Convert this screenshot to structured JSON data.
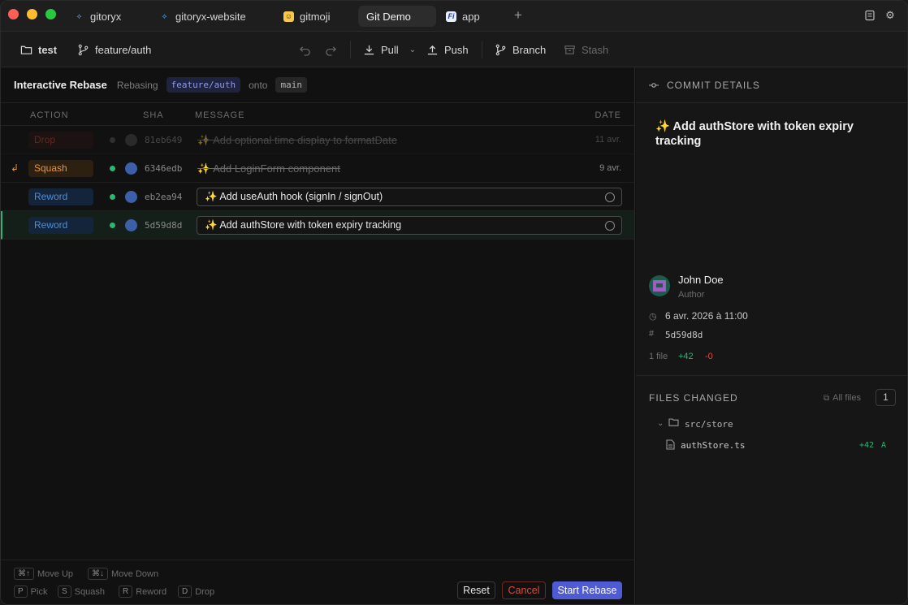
{
  "window": {
    "traffic_lights": {
      "close": "#fe5f57",
      "minimize": "#febc2e",
      "maximize": "#28c840"
    }
  },
  "tabs": [
    {
      "label": "gitoryx",
      "icon": "git-logo-icon"
    },
    {
      "label": "gitoryx-website",
      "icon": "git-logo-icon"
    },
    {
      "label": "gitmoji",
      "icon": "emoji-icon"
    },
    {
      "label": "Git Demo",
      "icon": "",
      "active": true
    },
    {
      "label": "app",
      "icon": "figma-icon"
    }
  ],
  "toolbar": {
    "repo": "test",
    "branch": "feature/auth",
    "pull": "Pull",
    "push": "Push",
    "branch_btn": "Branch",
    "stash": "Stash"
  },
  "rebase": {
    "title": "Interactive Rebase",
    "rebasing_label": "Rebasing",
    "source_branch": "feature/auth",
    "onto_label": "onto",
    "target_branch": "main"
  },
  "columns": {
    "action": "ACTION",
    "sha": "SHA",
    "message": "MESSAGE",
    "date": "DATE"
  },
  "commits": [
    {
      "action": "Drop",
      "sha": "81eb649",
      "message": "✨ Add optional time display to formatDate",
      "date": "11 avr."
    },
    {
      "action": "Squash",
      "sha": "6346edb",
      "message": "✨ Add LoginForm component",
      "date": "9 avr."
    },
    {
      "action": "Reword",
      "sha": "eb2ea94",
      "message": "✨ Add useAuth hook (signIn / signOut)",
      "date": ""
    },
    {
      "action": "Reword",
      "sha": "5d59d8d",
      "message": "✨ Add authStore with token expiry tracking",
      "date": ""
    }
  ],
  "footer": {
    "hints": [
      {
        "key": "⌘↑",
        "label": "Move Up"
      },
      {
        "key": "⌘↓",
        "label": "Move Down"
      },
      {
        "key": "P",
        "label": "Pick"
      },
      {
        "key": "S",
        "label": "Squash"
      },
      {
        "key": "R",
        "label": "Reword"
      },
      {
        "key": "D",
        "label": "Drop"
      }
    ],
    "reset": "Reset",
    "cancel": "Cancel",
    "start": "Start Rebase"
  },
  "details": {
    "section_title": "COMMIT DETAILS",
    "commit_title": "✨ Add authStore with token expiry tracking",
    "author_name": "John Doe",
    "author_role": "Author",
    "date": "6 avr. 2026 à 11:00",
    "sha": "5d59d8d",
    "files_count": "1 file",
    "additions": "+42",
    "deletions": "-0"
  },
  "files_changed": {
    "title": "FILES CHANGED",
    "all_files": "All files",
    "count": "1",
    "folder": "src/store",
    "file": "authStore.ts",
    "file_additions": "+42",
    "file_status": "A"
  },
  "colors": {
    "drop": "#c0462f",
    "squash": "#e8953a",
    "reword": "#4d8fd6",
    "accent_green": "#2bb673",
    "primary": "#4f5bd5",
    "cancel": "#e04b3a"
  }
}
